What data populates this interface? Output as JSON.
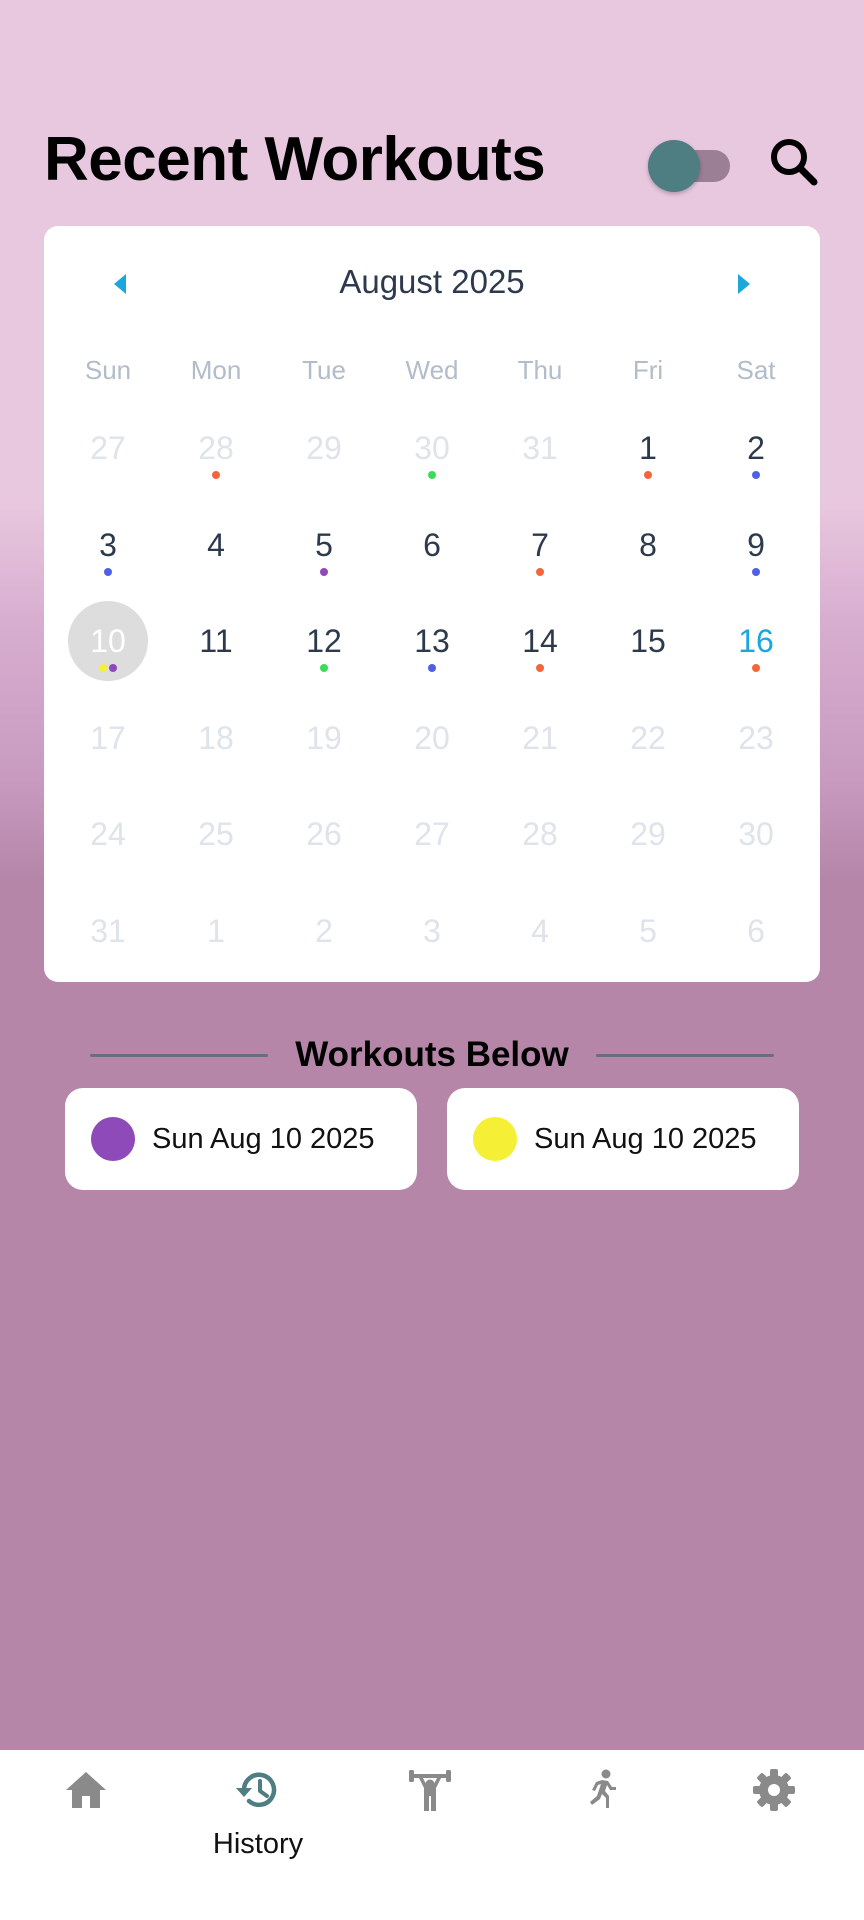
{
  "header": {
    "title": "Recent Workouts",
    "toggle_state": "off",
    "search_icon": "search-icon"
  },
  "calendar": {
    "month_label": "August 2025",
    "prev_icon": "triangle-left-icon",
    "next_icon": "triangle-right-icon",
    "weekdays": [
      "Sun",
      "Mon",
      "Tue",
      "Wed",
      "Thu",
      "Fri",
      "Sat"
    ],
    "weeks": [
      [
        {
          "day": "27",
          "outside": true
        },
        {
          "day": "28",
          "outside": true,
          "dots": [
            "#f4663a"
          ]
        },
        {
          "day": "29",
          "outside": true
        },
        {
          "day": "30",
          "outside": true,
          "dots": [
            "#3ddc58"
          ]
        },
        {
          "day": "31",
          "outside": true
        },
        {
          "day": "1",
          "dots": [
            "#f4663a"
          ]
        },
        {
          "day": "2",
          "dots": [
            "#4f5fe8"
          ]
        }
      ],
      [
        {
          "day": "3",
          "dots": [
            "#4f5fe8"
          ]
        },
        {
          "day": "4"
        },
        {
          "day": "5",
          "dots": [
            "#8e4ab8"
          ]
        },
        {
          "day": "6"
        },
        {
          "day": "7",
          "dots": [
            "#f4663a"
          ]
        },
        {
          "day": "8"
        },
        {
          "day": "9",
          "dots": [
            "#4f5fe8"
          ]
        }
      ],
      [
        {
          "day": "10",
          "selected": true,
          "dots": [
            "#f5f035",
            "#8e4ab8"
          ]
        },
        {
          "day": "11"
        },
        {
          "day": "12",
          "dots": [
            "#3ddc58"
          ]
        },
        {
          "day": "13",
          "dots": [
            "#4f5fe8"
          ]
        },
        {
          "day": "14",
          "dots": [
            "#f4663a"
          ]
        },
        {
          "day": "15"
        },
        {
          "day": "16",
          "today": true,
          "dots": [
            "#f4663a"
          ]
        }
      ],
      [
        {
          "day": "17",
          "outside": true
        },
        {
          "day": "18",
          "outside": true
        },
        {
          "day": "19",
          "outside": true
        },
        {
          "day": "20",
          "outside": true
        },
        {
          "day": "21",
          "outside": true
        },
        {
          "day": "22",
          "outside": true
        },
        {
          "day": "23",
          "outside": true
        }
      ],
      [
        {
          "day": "24",
          "outside": true
        },
        {
          "day": "25",
          "outside": true
        },
        {
          "day": "26",
          "outside": true
        },
        {
          "day": "27",
          "outside": true
        },
        {
          "day": "28",
          "outside": true
        },
        {
          "day": "29",
          "outside": true
        },
        {
          "day": "30",
          "outside": true
        }
      ],
      [
        {
          "day": "31",
          "outside": true
        },
        {
          "day": "1",
          "outside": true
        },
        {
          "day": "2",
          "outside": true
        },
        {
          "day": "3",
          "outside": true
        },
        {
          "day": "4",
          "outside": true
        },
        {
          "day": "5",
          "outside": true
        },
        {
          "day": "6",
          "outside": true
        }
      ]
    ]
  },
  "divider": {
    "label": "Workouts Below"
  },
  "workouts": [
    {
      "label": "Sun Aug 10 2025",
      "color": "#8e4ab8"
    },
    {
      "label": "Sun Aug 10 2025",
      "color": "#f5f035"
    }
  ],
  "bottom_nav": {
    "items": [
      {
        "icon": "home-icon",
        "label": ""
      },
      {
        "icon": "history-icon",
        "label": "History",
        "active": true
      },
      {
        "icon": "weightlifter-icon",
        "label": ""
      },
      {
        "icon": "runner-icon",
        "label": ""
      },
      {
        "icon": "gear-icon",
        "label": ""
      }
    ]
  },
  "colors": {
    "accent_blue": "#1ba7dc",
    "active_nav": "#4e7d82",
    "inactive_nav": "#8a8a8a",
    "background_bottom": "#b586a8",
    "background_top": "#e8c8df"
  }
}
